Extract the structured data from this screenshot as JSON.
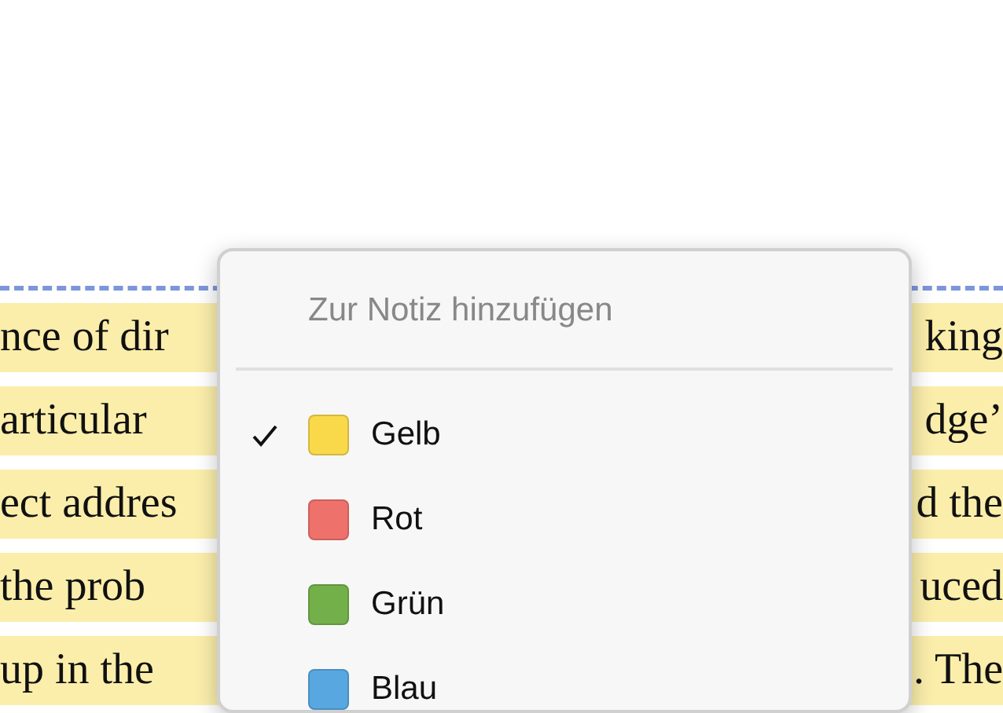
{
  "document": {
    "lines": [
      {
        "left": "nce of dir",
        "right": "king"
      },
      {
        "left": "articular",
        "right": "dge’"
      },
      {
        "left": "ect addres",
        "right": "d the"
      },
      {
        "left": "the prob",
        "right": "uced"
      },
      {
        "left": "up in the",
        "right": ". The"
      }
    ]
  },
  "menu": {
    "header": {
      "label": "Zur Notiz hinzufügen",
      "disabled": true
    },
    "items": [
      {
        "label": "Gelb",
        "color": "#f9d84a",
        "selected": true
      },
      {
        "label": "Rot",
        "color": "#ef716c",
        "selected": false
      },
      {
        "label": "Grün",
        "color": "#74b04a",
        "selected": false
      },
      {
        "label": "Blau",
        "color": "#58a7e0",
        "selected": false
      }
    ]
  }
}
